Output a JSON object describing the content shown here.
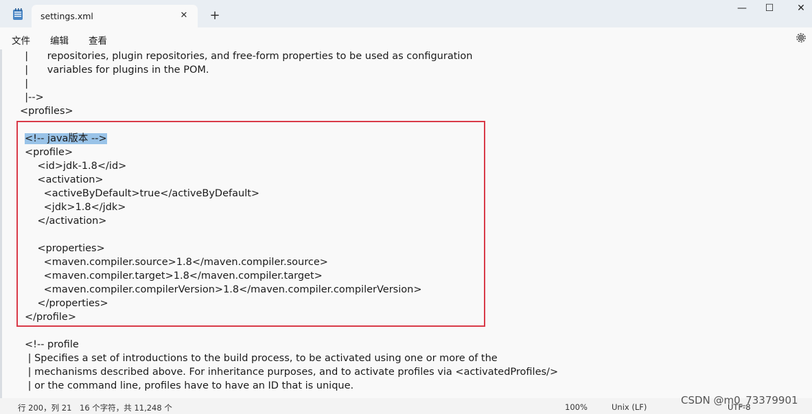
{
  "window": {
    "tab_title": "settings.xml",
    "close_glyph": "✕",
    "new_tab_glyph": "+",
    "minimize_glyph": "—",
    "maximize_glyph": "☐",
    "window_close_glyph": "✕"
  },
  "menu": {
    "file": "文件",
    "edit": "编辑",
    "view": "查看"
  },
  "editor": {
    "lines": [
      "  |      repositories, plugin repositories, and free-form properties to be used as configuration",
      "  |      variables for plugins in the POM.",
      "  |",
      "  |-->",
      "<profiles>",
      "",
      "<!-- java版本 -->",
      "<profile>",
      "    <id>jdk-1.8</id>",
      "    <activation>",
      "      <activeByDefault>true</activeByDefault>",
      "      <jdk>1.8</jdk>",
      "    </activation>",
      "",
      "    <properties>",
      "      <maven.compiler.source>1.8</maven.compiler.source>",
      "      <maven.compiler.target>1.8</maven.compiler.target>",
      "      <maven.compiler.compilerVersion>1.8</maven.compiler.compilerVersion>",
      "    </properties>",
      "</profile>",
      "",
      "<!-- profile",
      " | Specifies a set of introductions to the build process, to be activated using one or more of the",
      " | mechanisms described above. For inheritance purposes, and to activate profiles via <activatedProfiles/>",
      " | or the command line, profiles have to have an ID that is unique."
    ]
  },
  "status": {
    "position": "行 200，列 21",
    "selection": "16 个字符，共 11,248 个",
    "zoom": "100%",
    "line_ending": "Unix (LF)",
    "encoding": "UTF-8"
  },
  "watermark": "CSDN @m0_73379901",
  "colors": {
    "selection": "#99c3e8",
    "highlight_box": "#d93a48"
  }
}
